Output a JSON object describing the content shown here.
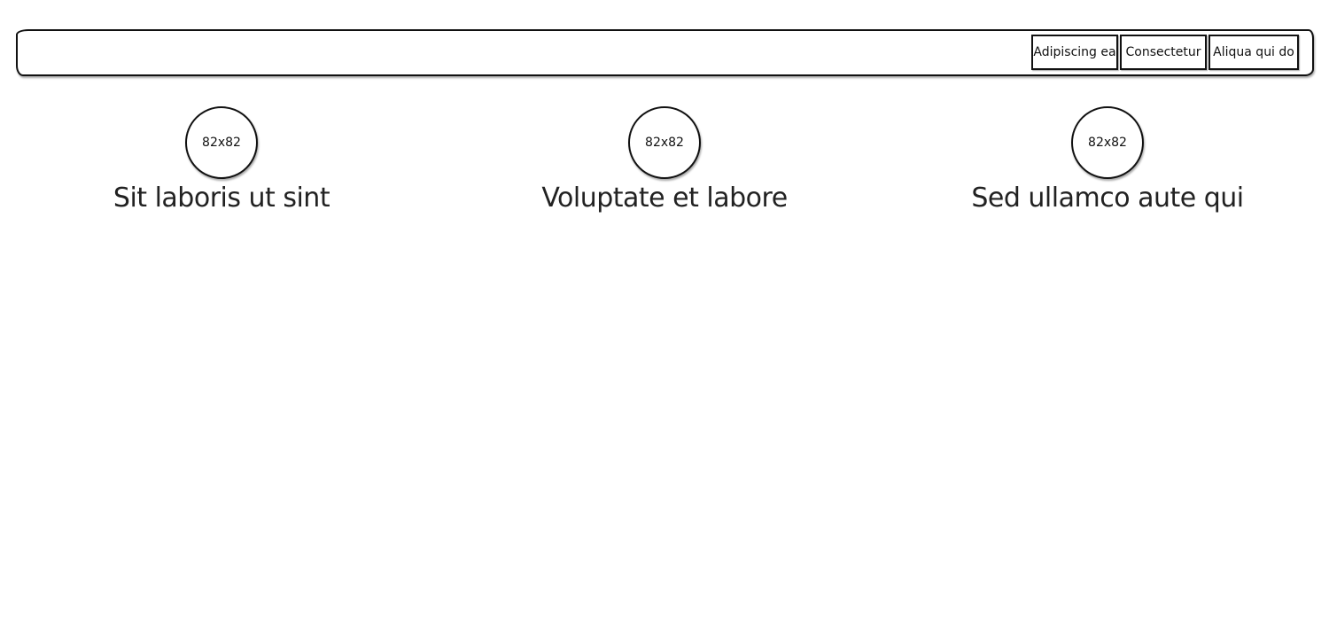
{
  "navbar": {
    "buttons": [
      {
        "label": "Adipiscing ea"
      },
      {
        "label": "Consectetur"
      },
      {
        "label": "Aliqua qui do"
      }
    ]
  },
  "features": [
    {
      "image_label": "82x82",
      "title": "Sit laboris ut sint"
    },
    {
      "image_label": "82x82",
      "title": "Voluptate et labore"
    },
    {
      "image_label": "82x82",
      "title": "Sed ullamco aute qui"
    }
  ]
}
